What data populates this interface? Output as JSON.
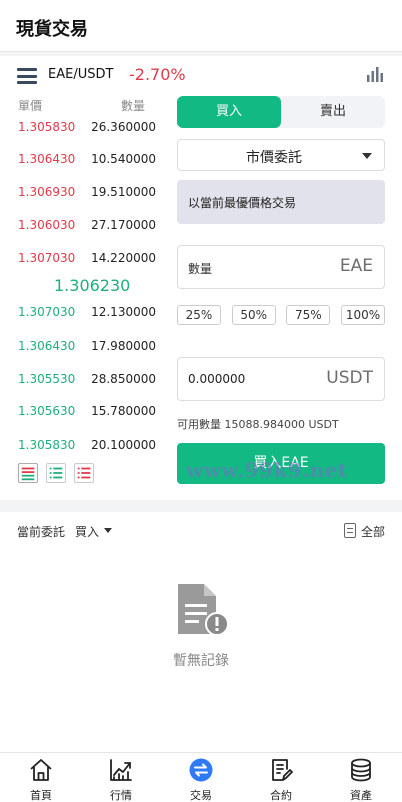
{
  "header": {
    "title": "現貨交易"
  },
  "pair": {
    "name": "EAE/USDT",
    "change": "-2.70%",
    "icons": {
      "menu": "menu-icon",
      "chart": "bar-chart-icon"
    }
  },
  "orderbook": {
    "price_header": "單價",
    "qty_header": "數量",
    "asks": [
      {
        "price": "1.305830",
        "qty": "26.360000"
      },
      {
        "price": "1.306430",
        "qty": "10.540000"
      },
      {
        "price": "1.306930",
        "qty": "19.510000"
      },
      {
        "price": "1.306030",
        "qty": "27.170000"
      },
      {
        "price": "1.307030",
        "qty": "14.220000"
      }
    ],
    "mid_price": "1.306230",
    "bids": [
      {
        "price": "1.307030",
        "qty": "12.130000"
      },
      {
        "price": "1.306430",
        "qty": "17.980000"
      },
      {
        "price": "1.305530",
        "qty": "28.850000"
      },
      {
        "price": "1.305630",
        "qty": "15.780000"
      },
      {
        "price": "1.305830",
        "qty": "20.100000"
      }
    ],
    "colors": {
      "ask": "#e0394a",
      "bid": "#1fae7a"
    }
  },
  "form": {
    "tabs": [
      {
        "label": "買入",
        "active": true
      },
      {
        "label": "賣出",
        "active": false
      }
    ],
    "order_type": "市價委託",
    "market_hint": "以當前最優價格交易",
    "qty_label": "數量",
    "qty_unit": "EAE",
    "percent_options": [
      "25%",
      "50%",
      "75%",
      "100%"
    ],
    "total_value": "0.000000",
    "total_unit": "USDT",
    "available": "可用數量 15088.984000 USDT",
    "submit_label": "買入EAE",
    "accent": "#13b983"
  },
  "watermark": "www.99k9.net",
  "orders": {
    "label": "當前委託",
    "filter": "買入",
    "all_label": "全部",
    "empty_text": "暫無記錄"
  },
  "nav": [
    {
      "label": "首頁",
      "icon": "home-icon"
    },
    {
      "label": "行情",
      "icon": "market-chart-icon"
    },
    {
      "label": "交易",
      "icon": "trade-exchange-icon",
      "active": true
    },
    {
      "label": "合約",
      "icon": "contract-icon"
    },
    {
      "label": "資產",
      "icon": "assets-icon"
    }
  ]
}
